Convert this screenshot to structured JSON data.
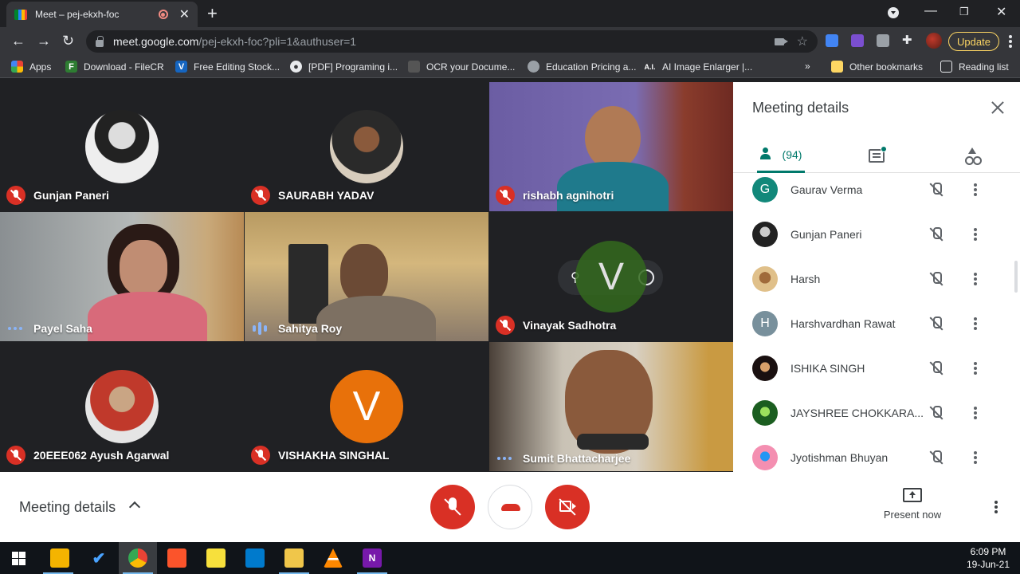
{
  "browser": {
    "tab_title": "Meet – pej-ekxh-foc",
    "url_host": "meet.google.com",
    "url_path": "/pej-ekxh-foc?pli=1&authuser=1",
    "update_label": "Update"
  },
  "bookmarks": [
    {
      "label": "Apps",
      "icon": "apps-grid-icon"
    },
    {
      "label": "Download - FileCR",
      "icon": "filecr-icon"
    },
    {
      "label": "Free Editing Stock...",
      "icon": "v-logo-icon"
    },
    {
      "label": "[PDF] Programing i...",
      "icon": "globe-icon"
    },
    {
      "label": "OCR your Docume...",
      "icon": "ocr-icon"
    },
    {
      "label": "Education Pricing a...",
      "icon": "apple-icon"
    },
    {
      "label": "AI Image Enlarger |...",
      "icon": "ai-icon"
    },
    {
      "label": "Other bookmarks",
      "icon": "folder-icon"
    },
    {
      "label": "Reading list",
      "icon": "reading-list-icon"
    }
  ],
  "tiles": [
    {
      "name": "Gunjan Paneri",
      "status": "muted"
    },
    {
      "name": "SAURABH YADAV",
      "status": "muted"
    },
    {
      "name": "rishabh agnihotri",
      "status": "muted"
    },
    {
      "name": "Payel Saha",
      "status": "speaking-idle"
    },
    {
      "name": "Sahitya Roy",
      "status": "speaking"
    },
    {
      "name": "Vinayak Sadhotra",
      "status": "muted",
      "initial": "V"
    },
    {
      "name": "20EEE062 Ayush Agarwal",
      "status": "muted"
    },
    {
      "name": "VISHAKHA SINGHAL",
      "status": "muted",
      "initial": "V"
    },
    {
      "name": "Sumit Bhattacharjee",
      "status": "speaking-idle"
    }
  ],
  "panel": {
    "title": "Meeting details",
    "people_count": "(94)",
    "people": [
      {
        "name": "Gaurav Verma",
        "initial": "G",
        "color": "#12887a"
      },
      {
        "name": "Gunjan Paneri",
        "initial": "",
        "color": "#2b2b2b"
      },
      {
        "name": "Harsh",
        "initial": "",
        "color": "#c9a06a"
      },
      {
        "name": "Harshvardhan Rawat",
        "initial": "H",
        "color": "#78909c"
      },
      {
        "name": "ISHIKA SINGH",
        "initial": "",
        "color": "#4a2c22"
      },
      {
        "name": "JAYSHREE CHOKKARA...",
        "initial": "",
        "color": "#4caf1f"
      },
      {
        "name": "Jyotishman Bhuyan",
        "initial": "",
        "color": "#e07ab8"
      }
    ]
  },
  "controls": {
    "meeting_details_label": "Meeting details",
    "present_label": "Present now"
  },
  "taskbar": {
    "time": "6:09 PM",
    "date": "19-Jun-21"
  },
  "colors": {
    "mute_red": "#d93025",
    "accent_teal": "#00796b",
    "avatar_orange": "#e8710a",
    "update_yellow": "#fdd663"
  }
}
